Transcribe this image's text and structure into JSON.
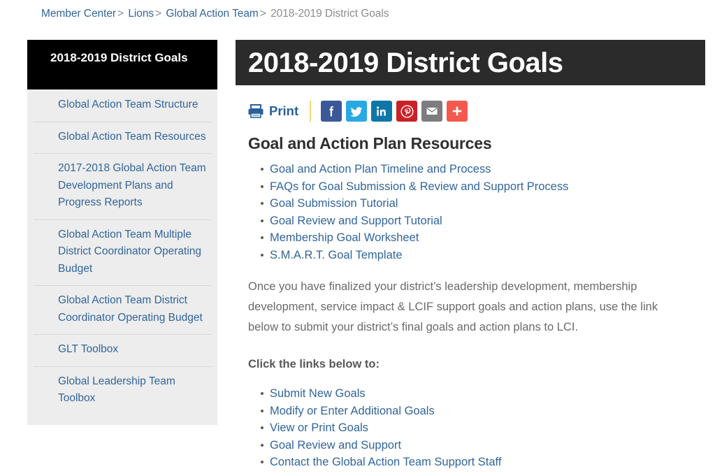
{
  "breadcrumb": {
    "items": [
      {
        "label": "Member Center",
        "link": true
      },
      {
        "label": "Lions",
        "link": true
      },
      {
        "label": "Global Action Team",
        "link": true
      },
      {
        "label": "2018-2019 District Goals",
        "link": false
      }
    ],
    "separator": ">"
  },
  "sidebar": {
    "title": "2018-2019 District Goals",
    "items": [
      {
        "label": "Global Action Team Structure"
      },
      {
        "label": "Global Action Team Resources"
      },
      {
        "label": "2017-2018 Global Action Team Development Plans and Progress Reports"
      },
      {
        "label": "Global Action Team Multiple District Coordinator Operating Budget"
      },
      {
        "label": "Global Action Team District Coordinator Operating Budget"
      },
      {
        "label": "GLT Toolbox"
      },
      {
        "label": "Global Leadership Team Toolbox"
      }
    ]
  },
  "page": {
    "title": "2018-2019 District Goals"
  },
  "toolbar": {
    "print_label": "Print",
    "print_icon": "printer-icon",
    "share": [
      {
        "name": "facebook-share-button",
        "icon": "facebook-icon",
        "color": "#3b5998"
      },
      {
        "name": "twitter-share-button",
        "icon": "twitter-icon",
        "color": "#29a9e1"
      },
      {
        "name": "linkedin-share-button",
        "icon": "linkedin-icon",
        "color": "#0e76a8"
      },
      {
        "name": "pinterest-share-button",
        "icon": "pinterest-icon",
        "color": "#cb2027"
      },
      {
        "name": "email-share-button",
        "icon": "envelope-icon",
        "color": "#7d7d7d"
      },
      {
        "name": "more-share-button",
        "icon": "plus-icon",
        "color": "#f4594d"
      }
    ],
    "divider_color": "#f0d878"
  },
  "content": {
    "heading": "Goal and Action Plan Resources",
    "resource_links": [
      "Goal and Action Plan Timeline and Process",
      "FAQs for Goal Submission & Review and Support Process",
      "Goal Submission Tutorial",
      "Goal Review and Support Tutorial",
      "Membership Goal Worksheet",
      "S.M.A.R.T. Goal Template"
    ],
    "paragraph": "Once you have finalized your district’s leadership development, membership development, service impact & LCIF support goals and action plans, use the link below to submit your district’s final goals and action plans to LCI.",
    "lead": "Click the links below to:",
    "action_links": [
      "Submit New Goals",
      "Modify or Enter Additional Goals",
      "View or Print Goals",
      "Goal Review and Support",
      "Contact the Global Action Team Support Staff"
    ]
  },
  "colors": {
    "link": "#31659c",
    "banner_bg": "#2b2b2b",
    "sidebar_header_bg": "#000000",
    "sidebar_bg": "#ededed",
    "body_text": "#6a6a6a"
  }
}
